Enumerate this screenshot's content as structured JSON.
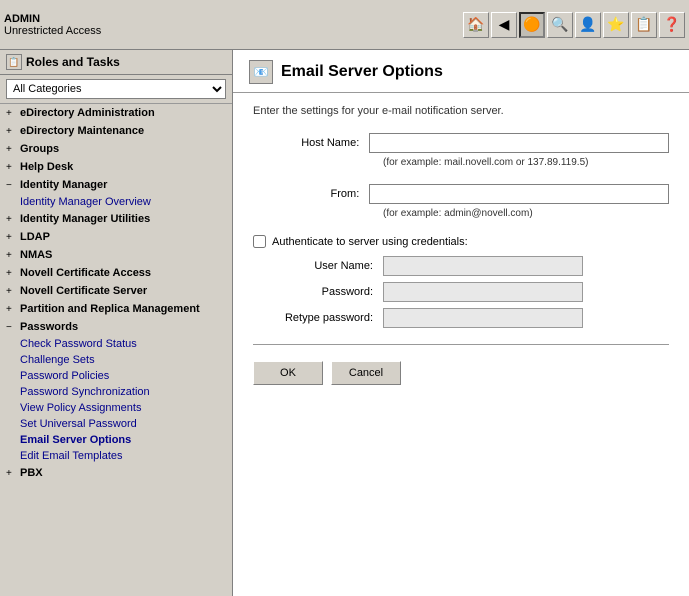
{
  "topbar": {
    "admin_label": "ADMIN",
    "unrestricted_label": "Unrestricted Access",
    "icons": [
      {
        "name": "home-icon",
        "symbol": "🏠"
      },
      {
        "name": "back-icon",
        "symbol": "◀"
      },
      {
        "name": "novell-icon",
        "symbol": "🔴"
      },
      {
        "name": "search-icon",
        "symbol": "🔍"
      },
      {
        "name": "user-icon",
        "symbol": "👤"
      },
      {
        "name": "star-icon",
        "symbol": "⭐"
      },
      {
        "name": "tasks-icon",
        "symbol": "📋"
      },
      {
        "name": "help-icon",
        "symbol": "❓"
      }
    ]
  },
  "sidebar": {
    "title": "Roles and Tasks",
    "dropdown": {
      "value": "All Categories",
      "options": [
        "All Categories"
      ]
    },
    "nav_items": [
      {
        "id": "edirectory-admin",
        "label": "eDirectory Administration",
        "expanded": false,
        "expandable": true
      },
      {
        "id": "edirectory-maint",
        "label": "eDirectory Maintenance",
        "expanded": false,
        "expandable": true
      },
      {
        "id": "groups",
        "label": "Groups",
        "expanded": false,
        "expandable": true
      },
      {
        "id": "help-desk",
        "label": "Help Desk",
        "expanded": false,
        "expandable": true
      },
      {
        "id": "identity-manager",
        "label": "Identity Manager",
        "expanded": true,
        "expandable": true,
        "sub_items": [
          {
            "id": "identity-manager-overview",
            "label": "Identity Manager Overview",
            "active": false
          }
        ]
      },
      {
        "id": "identity-manager-utilities",
        "label": "Identity Manager Utilities",
        "expanded": false,
        "expandable": true
      },
      {
        "id": "ldap",
        "label": "LDAP",
        "expanded": false,
        "expandable": true
      },
      {
        "id": "nmas",
        "label": "NMAS",
        "expanded": false,
        "expandable": true
      },
      {
        "id": "novell-cert-access",
        "label": "Novell Certificate Access",
        "expanded": false,
        "expandable": true
      },
      {
        "id": "novell-cert-server",
        "label": "Novell Certificate Server",
        "expanded": false,
        "expandable": true
      },
      {
        "id": "partition-replica",
        "label": "Partition and Replica Management",
        "expanded": false,
        "expandable": true
      },
      {
        "id": "passwords",
        "label": "Passwords",
        "expanded": true,
        "expandable": true,
        "sub_items": [
          {
            "id": "check-password-status",
            "label": "Check Password Status",
            "active": false
          },
          {
            "id": "challenge-sets",
            "label": "Challenge Sets",
            "active": false
          },
          {
            "id": "password-policies",
            "label": "Password Policies",
            "active": false
          },
          {
            "id": "password-synchronization",
            "label": "Password Synchronization",
            "active": false
          },
          {
            "id": "view-policy-assignments",
            "label": "View Policy Assignments",
            "active": false
          },
          {
            "id": "set-universal-password",
            "label": "Set Universal Password",
            "active": false
          },
          {
            "id": "email-server-options",
            "label": "Email Server Options",
            "active": true
          },
          {
            "id": "edit-email-templates",
            "label": "Edit Email Templates",
            "active": false
          }
        ]
      },
      {
        "id": "pbx",
        "label": "PBX",
        "expanded": false,
        "expandable": true
      }
    ]
  },
  "content": {
    "title": "Email Server Options",
    "description": "Enter the settings for your e-mail notification server.",
    "form": {
      "host_name_label": "Host Name:",
      "host_name_value": "",
      "host_name_hint": "(for example: mail.novell.com or 137.89.119.5)",
      "from_label": "From:",
      "from_value": "",
      "from_hint": "(for example: admin@novell.com)",
      "authenticate_label": "Authenticate to server using credentials:",
      "authenticate_checked": false,
      "user_name_label": "User Name:",
      "user_name_value": "",
      "password_label": "Password:",
      "password_value": "",
      "retype_password_label": "Retype password:",
      "retype_password_value": ""
    },
    "buttons": {
      "ok_label": "OK",
      "cancel_label": "Cancel"
    }
  }
}
